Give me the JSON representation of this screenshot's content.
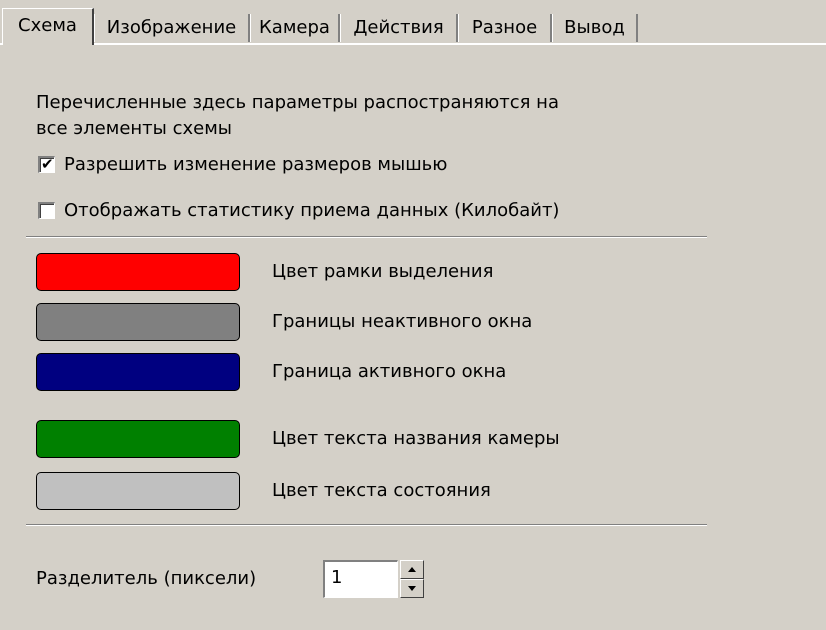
{
  "tabs": [
    {
      "label": "Схема",
      "active": true
    },
    {
      "label": "Изображение",
      "active": false
    },
    {
      "label": "Камера",
      "active": false
    },
    {
      "label": "Действия",
      "active": false
    },
    {
      "label": "Разное",
      "active": false
    },
    {
      "label": "Вывод",
      "active": false
    }
  ],
  "description": {
    "line1": "Перечисленные здесь параметры распостраняются на",
    "line2": "все элементы схемы"
  },
  "options": {
    "resize_by_mouse": {
      "label": "Разрешить изменение размеров мышью",
      "checked": true
    },
    "show_stats": {
      "label": "Отображать статистику приема данных (Килобайт)",
      "checked": false
    }
  },
  "colors": [
    {
      "label": "Цвет рамки выделения",
      "color": "#ff0000"
    },
    {
      "label": "Границы неактивного окна",
      "color": "#808080"
    },
    {
      "label": "Граница активного окна",
      "color": "#000080"
    },
    {
      "label": "Цвет текста названия камеры",
      "color": "#008000"
    },
    {
      "label": "Цвет текста состояния",
      "color": "#c0c0c0"
    }
  ],
  "separator": {
    "label": "Разделитель (пиксели)",
    "value": "1"
  }
}
